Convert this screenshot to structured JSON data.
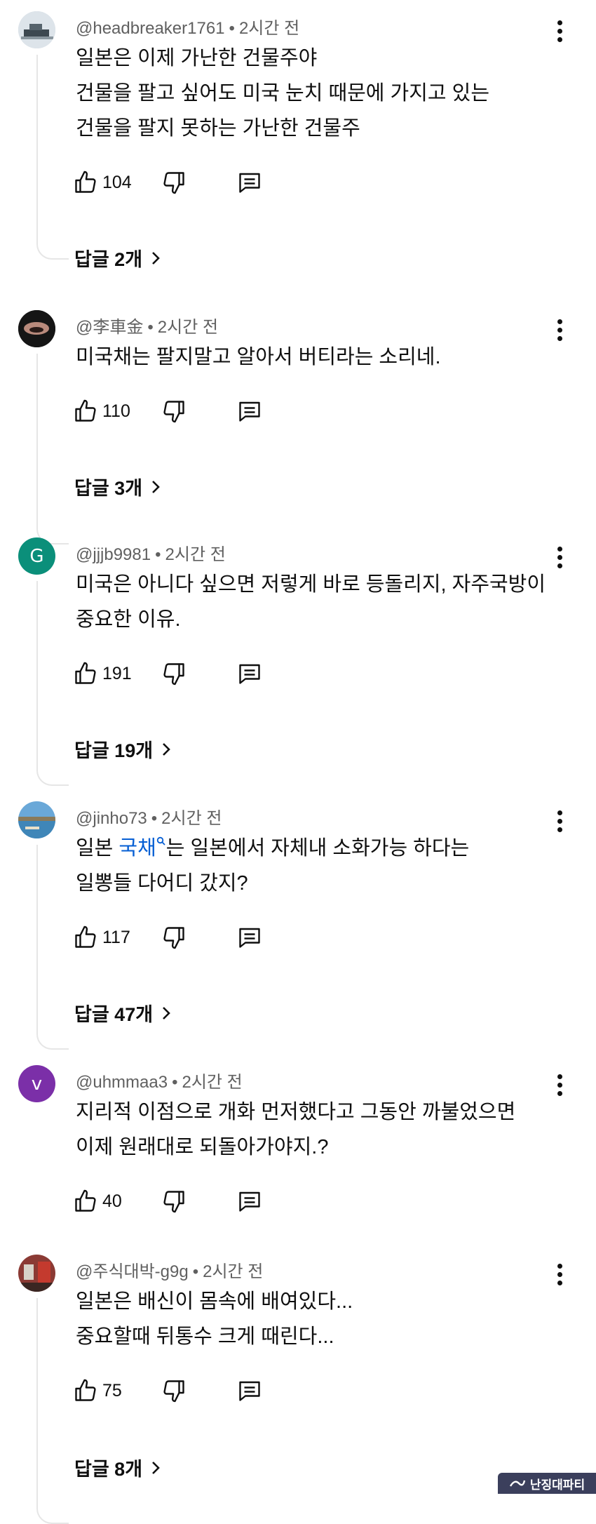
{
  "comments": [
    {
      "author": "@headbreaker1761",
      "time": "2시간 전",
      "lines": [
        "일본은 이제 가난한 건물주야",
        "건물을 팔고 싶어도 미국 눈치 때문에 가지고 있는",
        "건물을 팔지 못하는 가난한 건물주"
      ],
      "likes": "104",
      "replies": "답글 2개"
    },
    {
      "author": "@李車金",
      "time": "2시간 전",
      "lines": [
        "미국채는 팔지말고 알아서 버티라는 소리네."
      ],
      "likes": "110",
      "replies": "답글 3개"
    },
    {
      "author": "@jjjb9981",
      "time": "2시간 전",
      "avatar_letter": "G",
      "avatar_color": "#0b8f7a",
      "lines": [
        "미국은 아니다 싶으면 저렇게 바로 등돌리지, 자주국방이",
        "중요한 이유."
      ],
      "likes": "191",
      "replies": "답글 19개"
    },
    {
      "author": "@jinho73",
      "time": "2시간 전",
      "line1_before": "일본 ",
      "line1_link": "국채",
      "line1_after": "는  일본에서 자체내 소화가능  하다는",
      "line2": "일뽕들  다어디  갔지?",
      "likes": "117",
      "replies": "답글 47개"
    },
    {
      "author": "@uhmmaa3",
      "time": "2시간 전",
      "avatar_letter": "v",
      "avatar_color": "#7b2fa8",
      "lines": [
        "지리적 이점으로 개화 먼저했다고 그동안 까불었으면",
        "이제 원래대로 되돌아가야지.?"
      ],
      "likes": "40"
    },
    {
      "author": "@주식대박-g9g",
      "time": "2시간 전",
      "lines": [
        "일본은 배신이 몸속에 배여있다...",
        "중요할때 뒤통수 크게 때린다..."
      ],
      "likes": "75",
      "replies": "답글 8개"
    }
  ],
  "watermark": "난징대파티",
  "dot": "•",
  "icons": [
    "like-icon",
    "dislike-icon",
    "reply-icon",
    "more-vert-icon",
    "chevron-right-icon"
  ]
}
